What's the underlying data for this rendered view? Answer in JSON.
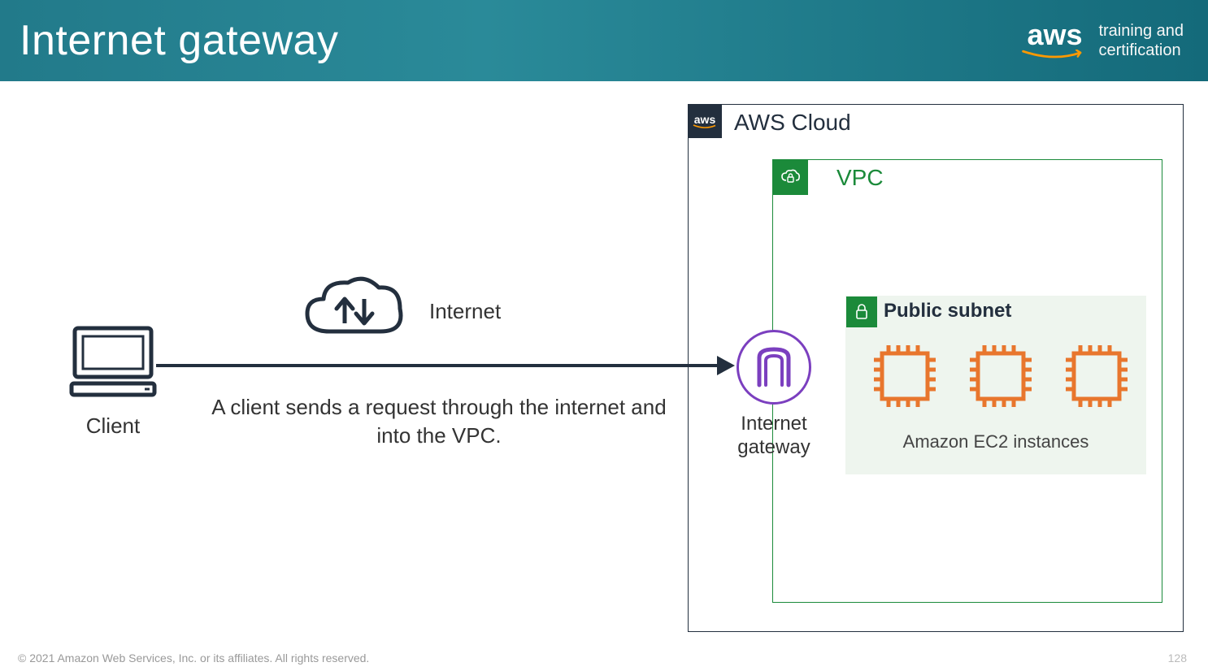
{
  "header": {
    "title": "Internet gateway",
    "brand_logo": "aws",
    "brand_sub1": "training and",
    "brand_sub2": "certification"
  },
  "diagram": {
    "client_label": "Client",
    "internet_label": "Internet",
    "description": "A client sends a request through the internet and into the VPC.",
    "aws_cloud_label": "AWS Cloud",
    "vpc_label": "VPC",
    "subnet_label": "Public subnet",
    "ec2_caption": "Amazon EC2 instances",
    "igw_label": "Internet gateway"
  },
  "footer": {
    "copyright": "© 2021 Amazon Web Services, Inc. or its affiliates. All rights reserved.",
    "page_number": "128"
  },
  "colors": {
    "header_gradient_start": "#227a8a",
    "header_gradient_end": "#146a7a",
    "aws_orange": "#ff9900",
    "navy": "#232f3e",
    "green": "#1b8a3a",
    "purple": "#7b3fbf",
    "ec2_orange": "#e8762d"
  }
}
